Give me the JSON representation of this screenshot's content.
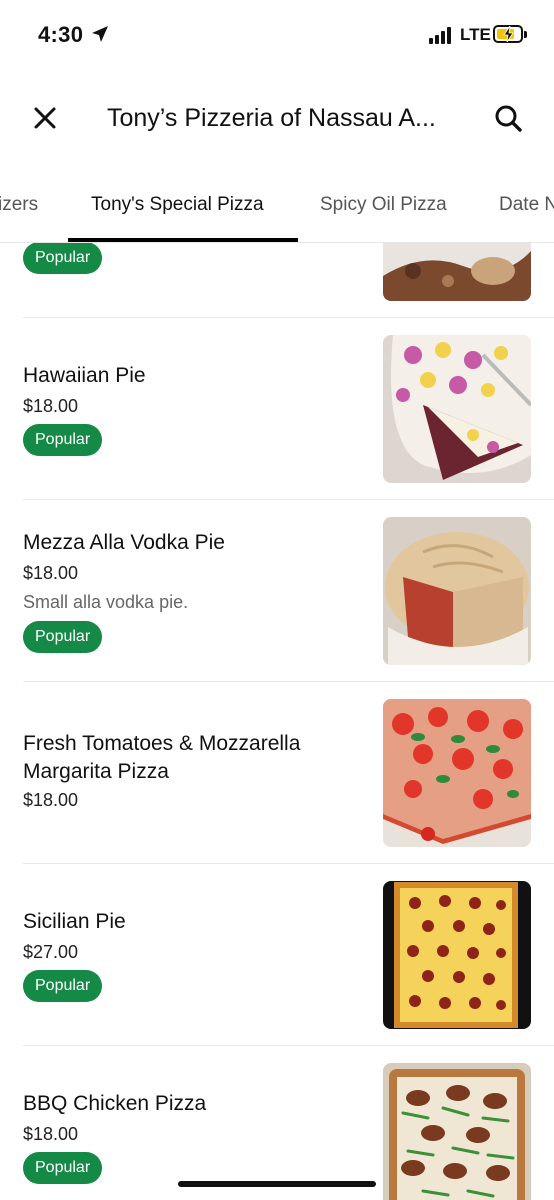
{
  "status_bar": {
    "time": "4:30",
    "network": "LTE",
    "icons": [
      "location-arrow-icon",
      "signal-bars-icon",
      "battery-charging-icon"
    ]
  },
  "header": {
    "title": "Tony’s Pizzeria of Nassau A...",
    "icons": [
      "close-icon",
      "search-icon"
    ]
  },
  "tabs": [
    {
      "label": "izers"
    },
    {
      "label": "Tony's Special Pizza",
      "active": true
    },
    {
      "label": "Spicy Oil Pizza"
    },
    {
      "label": "Date N"
    }
  ],
  "menu_items": [
    {
      "name": "",
      "price": "",
      "badge": "Popular"
    },
    {
      "name": "Hawaiian Pie",
      "price": "$18.00",
      "badge": "Popular"
    },
    {
      "name": "Mezza Alla Vodka Pie",
      "price": "$18.00",
      "description": "Small alla vodka pie.",
      "badge": "Popular"
    },
    {
      "name": "Fresh Tomatoes & Mozzarella Margarita Pizza",
      "price": "$18.00"
    },
    {
      "name": "Sicilian Pie",
      "price": "$27.00",
      "badge": "Popular"
    },
    {
      "name": "BBQ Chicken Pizza",
      "price": "$18.00",
      "badge": "Popular"
    }
  ],
  "colors": {
    "popular_badge": "#148a46",
    "active_tab_underline": "#000000",
    "battery_fill": "#f5c400"
  }
}
